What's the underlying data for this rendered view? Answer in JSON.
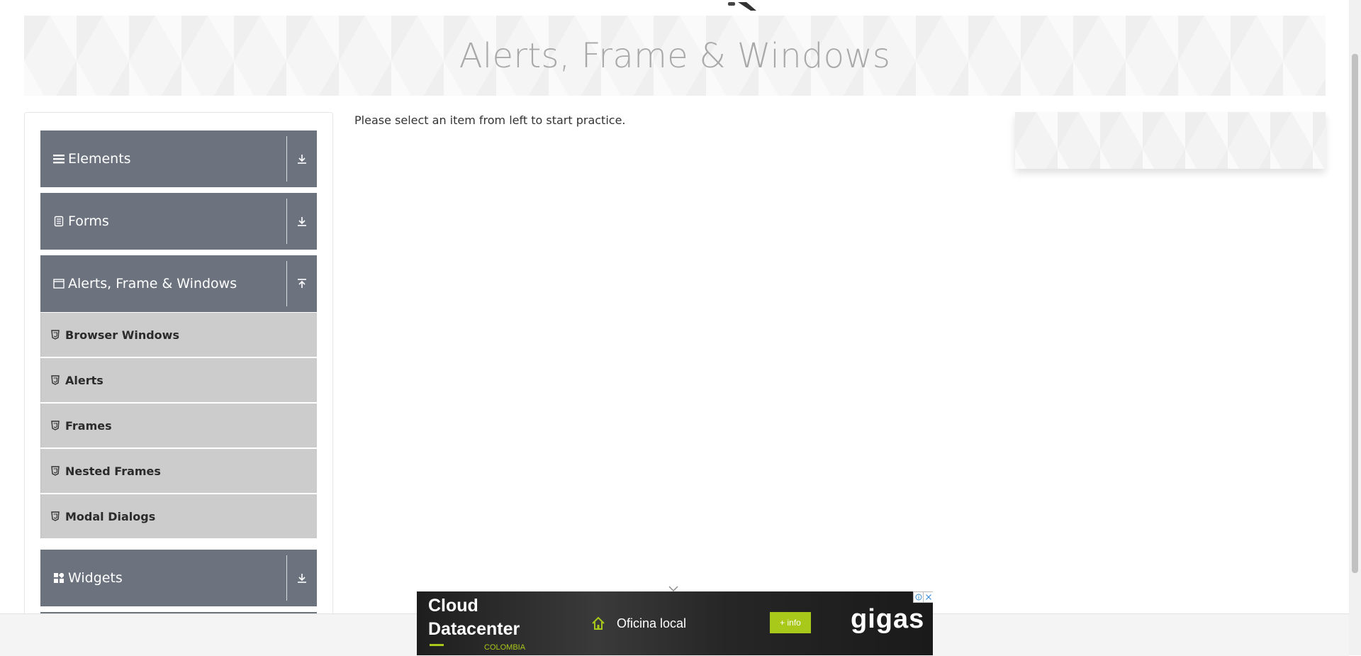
{
  "page": {
    "title": "Alerts, Frame & Windows",
    "intro": "Please select an item from left to start practice."
  },
  "sidebar": {
    "groups": [
      {
        "label": "Elements",
        "icon": "menu-icon",
        "expanded": false
      },
      {
        "label": "Forms",
        "icon": "document-icon",
        "expanded": false
      },
      {
        "label": "Alerts, Frame & Windows",
        "icon": "window-icon",
        "expanded": true
      },
      {
        "label": "Widgets",
        "icon": "widgets-icon",
        "expanded": false
      }
    ],
    "items": [
      {
        "label": "Browser Windows"
      },
      {
        "label": "Alerts"
      },
      {
        "label": "Frames"
      },
      {
        "label": "Nested Frames"
      },
      {
        "label": "Modal Dialogs"
      }
    ]
  },
  "ad": {
    "title_line1": "Cloud",
    "title_line2": "Datacenter",
    "country": "COLOMBIA",
    "office": "Oficina local",
    "more": "+ info",
    "brand": "gigas"
  },
  "colors": {
    "group_bg": "#6c737f",
    "item_bg": "#cccccc",
    "accent": "#a8c81a"
  }
}
